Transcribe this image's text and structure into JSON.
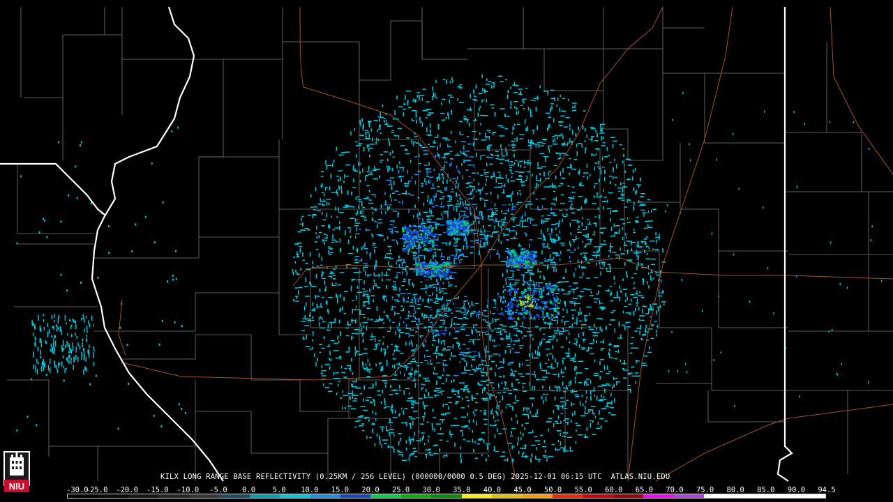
{
  "product_title": "KILX LONG RANGE BASE REFLECTIVITY (0.25KM / 256 LEVEL) (000000/0000 0.5 DEG) 2025-12-01 06:15 UTC  ATLAS.NIU.EDU",
  "logo_text": "NIU",
  "scale": {
    "labels": [
      "-30.0",
      "-25.0",
      "-20.0",
      "-15.0",
      "-10.0",
      "-5.0",
      "0.0",
      "5.0",
      "10.0",
      "15.0",
      "20.0",
      "25.0",
      "30.0",
      "35.0",
      "40.0",
      "45.0",
      "50.0",
      "55.0",
      "60.0",
      "65.0",
      "70.0",
      "75.0",
      "80.0",
      "85.0",
      "90.0",
      "94.5"
    ],
    "colors": [
      "#000000",
      "#0b0b0b",
      "#161616",
      "#262626",
      "#363636",
      "#1c4c60",
      "#00a0b8",
      "#00c8dc",
      "#1c90e8",
      "#1446c8",
      "#00d24a",
      "#00b400",
      "#009000",
      "#ffee00",
      "#e6c000",
      "#ff9a00",
      "#ff2000",
      "#d20000",
      "#a00000",
      "#ff00ff",
      "#b040e0",
      "#ffffff",
      "#ffffff",
      "#ffffff",
      "#ffffff"
    ]
  },
  "radar": {
    "site": "KILX",
    "colors": {
      "light": "#00c8dc",
      "mid": "#1c90e8",
      "strong": "#1446c8",
      "green": "#00d24a",
      "yellow": "#e6e600"
    },
    "map_colors": {
      "county": "#7a7a7a",
      "state": "#ffffff",
      "highway": "#a0522d"
    }
  }
}
